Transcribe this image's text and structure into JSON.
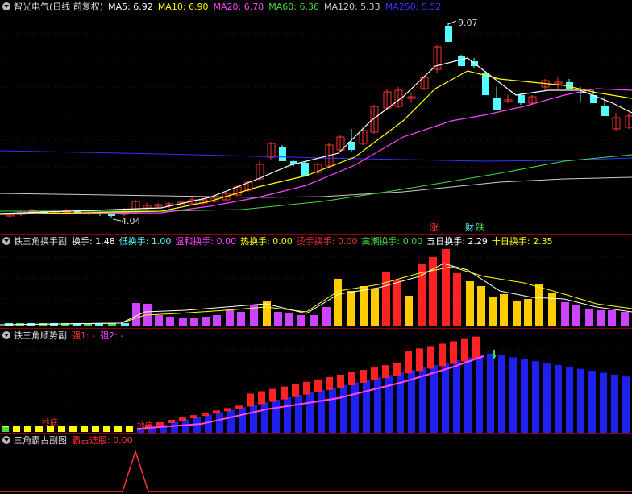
{
  "main": {
    "title": "智光电气(日线 前复权)",
    "ma": [
      {
        "label": "MA5: 6.92",
        "color": "#ffffff"
      },
      {
        "label": "MA10: 6.90",
        "color": "#ffff00"
      },
      {
        "label": "MA20: 6.78",
        "color": "#ff44ff"
      },
      {
        "label": "MA60: 6.36",
        "color": "#44dd44"
      },
      {
        "label": "MA120: 5.33",
        "color": "#cccccc"
      },
      {
        "label": "MA250: 5.52",
        "color": "#3333ff"
      }
    ],
    "high_label": "9.07",
    "low_label": "4.04",
    "tag_rise": "涨",
    "tag_fin": "财",
    "tag_fall": "跌",
    "up_color": "#ff3232",
    "down_color": "#54ffff"
  },
  "sub1": {
    "title": "铁三角换手副",
    "fields": [
      {
        "label": "换手: 1.48",
        "color": "#ffffff"
      },
      {
        "label": "低换手: 1.00",
        "color": "#54ffff"
      },
      {
        "label": "温和换手: 0.00",
        "color": "#ff44ff"
      },
      {
        "label": "热换手: 0.00",
        "color": "#ffff00"
      },
      {
        "label": "烫手换手: 0.00",
        "color": "#ff3232"
      },
      {
        "label": "高潮换手: 0.00",
        "color": "#44dd44"
      },
      {
        "label": "五日换手: 2.29",
        "color": "#ffffff"
      },
      {
        "label": "十日换手: 2.35",
        "color": "#ffff00"
      }
    ]
  },
  "sub2": {
    "title": "铁三角顺势副",
    "fields": [
      {
        "label": "强1: -",
        "color": "#ff3232"
      },
      {
        "label": "强2: -",
        "color": "#ff44ff"
      }
    ],
    "marker1": "抄底",
    "marker2": "抄底"
  },
  "sub3": {
    "title": "三角霸占副图",
    "fields": [
      {
        "label": "霸占选股: 0.00",
        "color": "#ff3232"
      }
    ]
  }
}
